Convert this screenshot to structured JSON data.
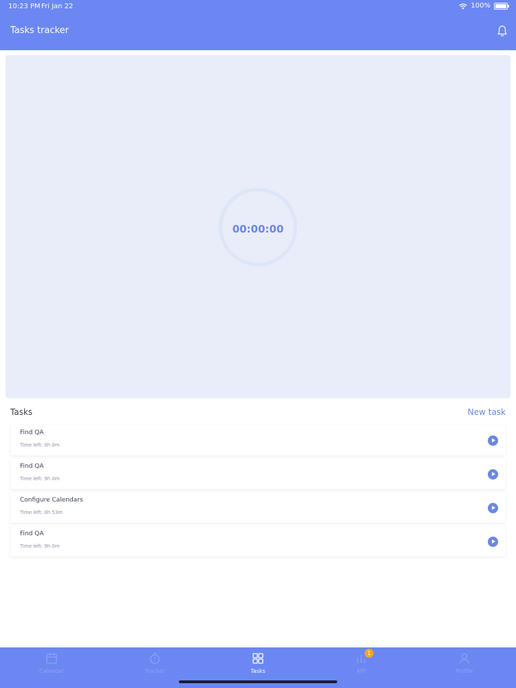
{
  "status_bar": {
    "time": "10:23 PM",
    "date": "Fri Jan 22",
    "battery": "100%"
  },
  "header": {
    "title": "Tasks tracker"
  },
  "timer": {
    "display": "00:00:00"
  },
  "tasks": {
    "title": "Tasks",
    "new_task_label": "New task",
    "items": [
      {
        "name": "Find QA",
        "time_left": "Time left: 0h 0m"
      },
      {
        "name": "Find QA",
        "time_left": "Time left: 9h 0m"
      },
      {
        "name": "Configure Calendars",
        "time_left": "Time left: 0h 53m"
      },
      {
        "name": "Find QA",
        "time_left": "Time left: 9h 0m"
      }
    ]
  },
  "tabbar": {
    "tabs": [
      {
        "label": "Calendar",
        "icon": "calendar-icon"
      },
      {
        "label": "Tracker",
        "icon": "stopwatch-icon"
      },
      {
        "label": "Tasks",
        "icon": "grid-icon",
        "active": true
      },
      {
        "label": "KPI",
        "icon": "kpi-icon",
        "badge": "1"
      },
      {
        "label": "Profile",
        "icon": "person-icon"
      }
    ]
  },
  "colors": {
    "accent": "#6b87f2",
    "panel": "#e8edf9",
    "badge": "#f5a623"
  }
}
